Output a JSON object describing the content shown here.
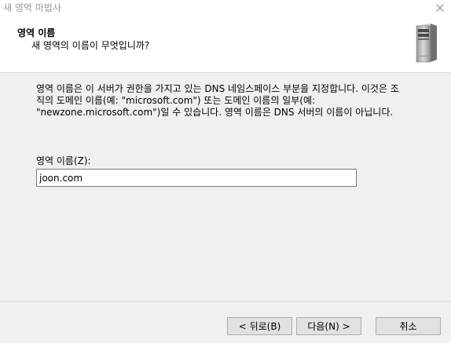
{
  "window": {
    "title": "새 영역 마법사",
    "close_icon": "close-icon"
  },
  "header": {
    "title": "영역 이름",
    "subtitle": "새 영역의 이름이 무엇입니까?",
    "icon": "server-icon"
  },
  "main": {
    "description": "영역 이름은 이 서버가 권한을 가지고 있는 DNS 네임스페이스 부분을 지정합니다. 이것은 조\n직의 도메인 이름(예: \"microsoft.com\") 또는 도메인 이름의 일부(예:\n\"newzone.microsoft.com\")일 수 있습니다. 영역 이름은 DNS 서버의 이름이 아닙니다.",
    "zone_name_label": "영역 이름(Z):",
    "zone_name_value": "joon.com"
  },
  "footer": {
    "back_label": "< 뒤로(B)",
    "next_label": "다음(N) >",
    "cancel_label": "취소"
  }
}
